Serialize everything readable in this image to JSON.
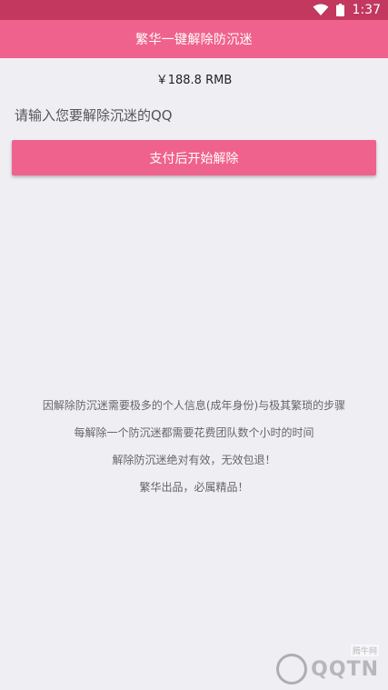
{
  "status_bar": {
    "time": "1:37",
    "icons": [
      "wifi-icon",
      "battery-icon"
    ]
  },
  "app_bar": {
    "title": "繁华一键解除防沉迷"
  },
  "main": {
    "price": "￥188.8 RMB",
    "qq_input": {
      "placeholder": "请输入您要解除沉迷的QQ",
      "value": ""
    },
    "pay_button_label": "支付后开始解除"
  },
  "notes": [
    "因解除防沉迷需要极多的个人信息(成年身份)与极其繁琐的步骤",
    "每解除一个防沉迷都需要花费团队数个小时的时间",
    "解除防沉迷绝对有效，无效包退！",
    "繁华出品，必属精品！"
  ],
  "watermark": {
    "text": "QQTN",
    "sub": "腾牛网"
  },
  "colors": {
    "status_bar": "#c2385f",
    "primary": "#f0628e",
    "background": "#efeef3"
  }
}
